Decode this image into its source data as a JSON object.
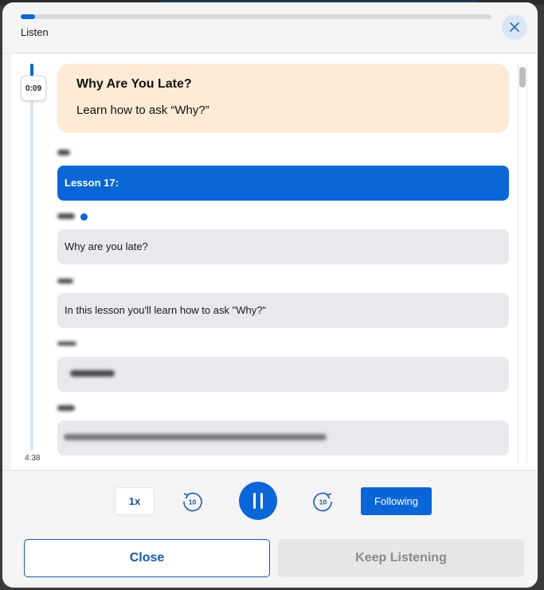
{
  "header": {
    "label": "Listen",
    "progress_fraction": 0.03
  },
  "player": {
    "current_time": "0:09",
    "total_time": "4:38",
    "speed": "1x",
    "skip_back_seconds": "10",
    "skip_forward_seconds": "10",
    "following_label": "Following"
  },
  "lesson": {
    "title": "Why Are You Late?",
    "subtitle": "Learn how to ask “Why?”"
  },
  "transcript": [
    {
      "text": "Lesson 17:",
      "active": true
    },
    {
      "text": "Why are you late?",
      "active": false
    },
    {
      "text": "In this lesson you'll learn how to ask \"Why?\"",
      "active": false
    },
    {
      "text": "",
      "active": false
    },
    {
      "text": "",
      "active": false
    }
  ],
  "footer": {
    "close_label": "Close",
    "keep_listening_label": "Keep Listening"
  },
  "colors": {
    "accent": "#0a66d6",
    "title_card": "#fdebd6",
    "line_bg": "#e8e8ee"
  }
}
